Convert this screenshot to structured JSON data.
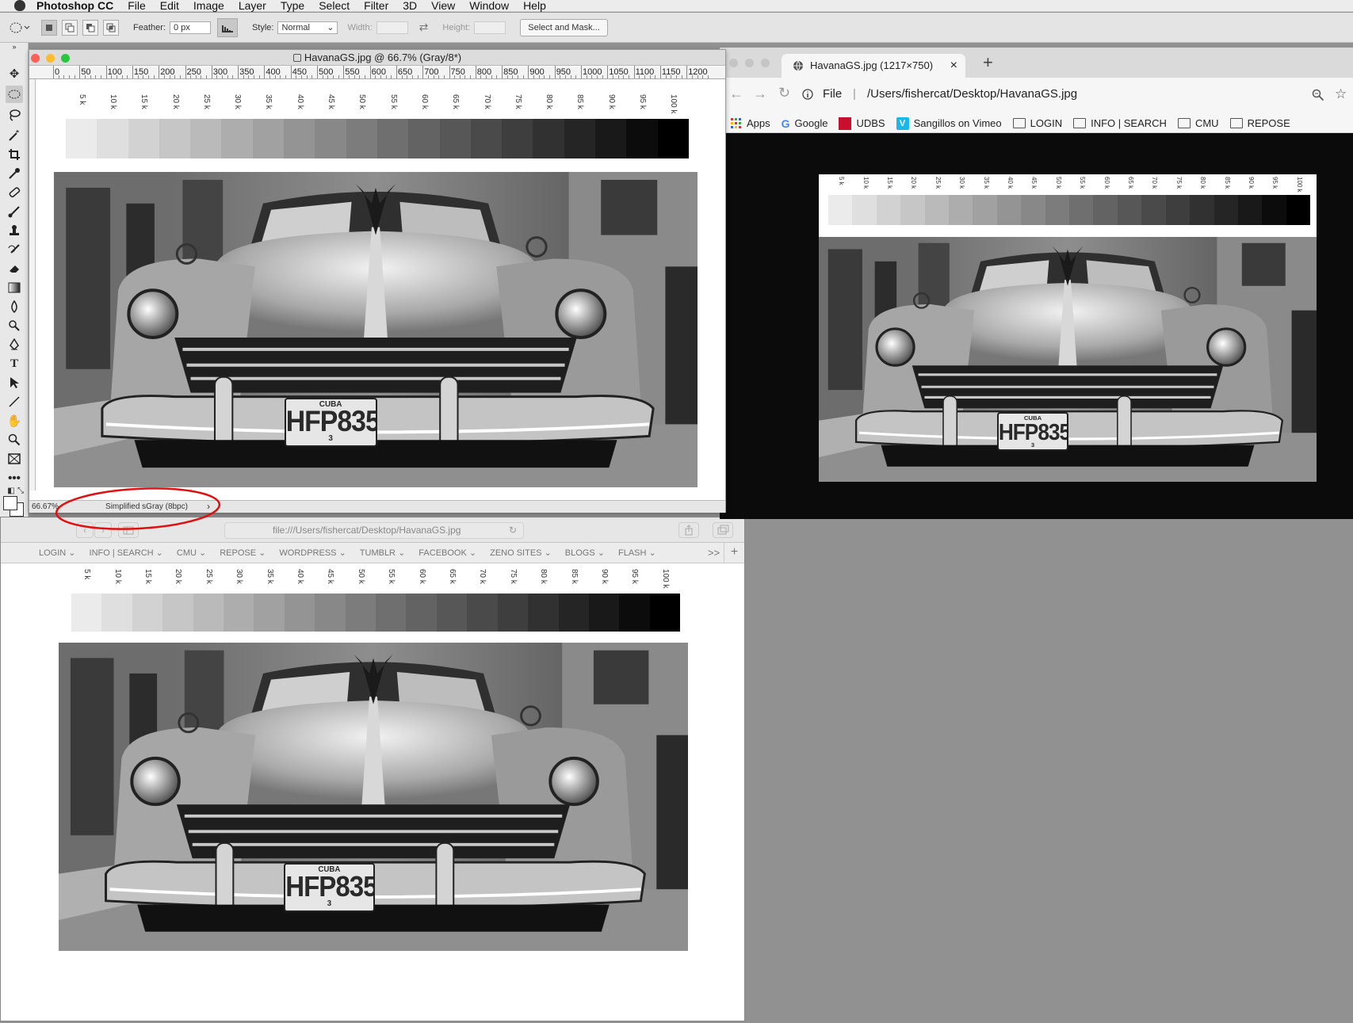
{
  "menubar": {
    "app_name": "Photoshop CC",
    "items": [
      "File",
      "Edit",
      "Image",
      "Layer",
      "Type",
      "Select",
      "Filter",
      "3D",
      "View",
      "Window",
      "Help"
    ]
  },
  "options_bar": {
    "feather_label": "Feather:",
    "feather_value": "0 px",
    "style_label": "Style:",
    "style_value": "Normal",
    "width_label": "Width:",
    "height_label": "Height:",
    "select_mask_label": "Select and Mask..."
  },
  "ps_doc": {
    "title": "HavanaGS.jpg @ 66.7% (Gray/8*)",
    "ruler": [
      "0",
      "50",
      "100",
      "150",
      "200",
      "250",
      "300",
      "350",
      "400",
      "450",
      "500",
      "550",
      "600",
      "650",
      "700",
      "750",
      "800",
      "850",
      "900",
      "950",
      "1000",
      "1050",
      "1100",
      "1150",
      "1200"
    ],
    "zoom": "66.67%",
    "doc_profile": "Simplified sGray (8bpc)",
    "status_arrow": "›"
  },
  "grayscale": {
    "labels": [
      "5 k",
      "10 k",
      "15 k",
      "20 k",
      "25 k",
      "30 k",
      "35 k",
      "40 k",
      "45 k",
      "50 k",
      "55 k",
      "60 k",
      "65 k",
      "70 k",
      "75 k",
      "80 k",
      "85 k",
      "90 k",
      "95 k",
      "100 k"
    ],
    "levels_percent": [
      5,
      10,
      15,
      20,
      25,
      30,
      35,
      40,
      45,
      50,
      55,
      60,
      65,
      70,
      75,
      80,
      85,
      90,
      95,
      100
    ]
  },
  "plate": {
    "country": "CUBA",
    "number": "HFP835",
    "sub": "3"
  },
  "chrome": {
    "tab_title": "HavanaGS.jpg (1217×750)",
    "close": "×",
    "new_tab": "+",
    "scheme_label": "File",
    "url_divider": "|",
    "url": "/Users/fishercat/Desktop/HavanaGS.jpg",
    "bookmarks": [
      "Apps",
      "Google",
      "UDBS",
      "Sangillos on Vimeo",
      "LOGIN",
      "INFO | SEARCH",
      "CMU",
      "REPOSE"
    ]
  },
  "safari": {
    "url": "file:///Users/fishercat/Desktop/HavanaGS.jpg",
    "favorites": [
      "LOGIN",
      "INFO | SEARCH",
      "CMU",
      "REPOSE",
      "WORDPRESS",
      "TUMBLR",
      "FACEBOOK",
      "ZENO SITES",
      "BLOGS",
      "FLASH"
    ],
    "overflow": ">>",
    "add": "+"
  },
  "colors": {
    "annotation_circle": "#e01010",
    "ps_red_light": "#fc5f57",
    "ps_yellow_light": "#fdbc2e",
    "ps_green_light": "#27c840"
  }
}
